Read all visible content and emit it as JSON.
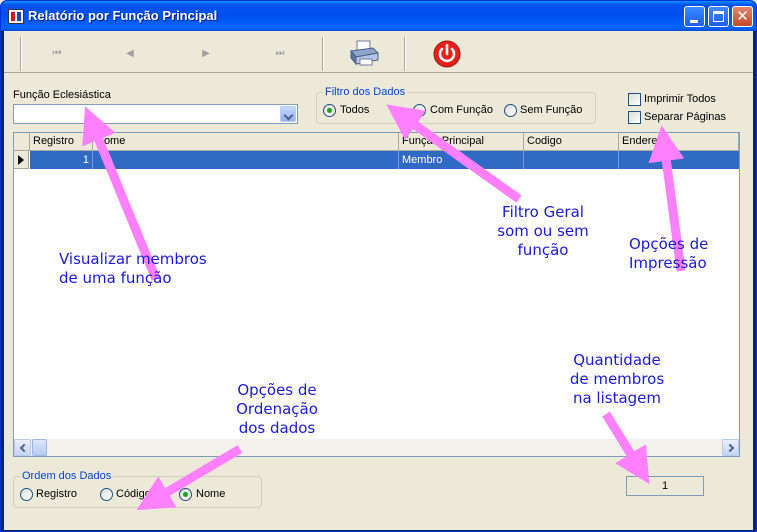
{
  "window": {
    "title": "Relatório por Função Principal",
    "close_glyph": "✕"
  },
  "toolbar": {
    "first_glyph": "⏮",
    "prev_glyph": "◀",
    "next_glyph": "▶",
    "last_glyph": "⏭"
  },
  "funcao": {
    "label": "Função Eclesiástica",
    "value": ""
  },
  "filtro": {
    "legend": "Filtro dos Dados",
    "options": [
      "Todos",
      "Com Função",
      "Sem Função"
    ],
    "selected": "Todos"
  },
  "impressao": {
    "imprimir_todos": "Imprimir Todos",
    "separar_paginas": "Separar Páginas"
  },
  "grid": {
    "columns": [
      "Registro",
      "Nome",
      "Função Principal",
      "Codigo",
      "Endereco"
    ],
    "rows": [
      {
        "registro": "1",
        "nome": "",
        "funcao": "Membro",
        "codigo": "",
        "endereco": ""
      }
    ]
  },
  "ordem": {
    "legend": "Ordem dos Dados",
    "options": [
      "Registro",
      "Código",
      "Nome"
    ],
    "selected": "Nome"
  },
  "count": "1",
  "annotations": {
    "funcao_line1": "Visualizar membros",
    "funcao_line2": "de uma função",
    "filtro_line1": "Filtro Geral",
    "filtro_line2": "som ou sem",
    "filtro_line3": "função",
    "impressao_line1": "Opções de",
    "impressao_line2": "Impressão",
    "ordem_line1": "Opções de",
    "ordem_line2": "Ordenação",
    "ordem_line3": "dos dados",
    "qtd_line1": "Quantidade",
    "qtd_line2": "de membros",
    "qtd_line3": "na listagem"
  },
  "colors": {
    "annotation_arrow": "#ff80ff",
    "annotation_text": "#1a1ad8",
    "selection": "#316ac5"
  }
}
